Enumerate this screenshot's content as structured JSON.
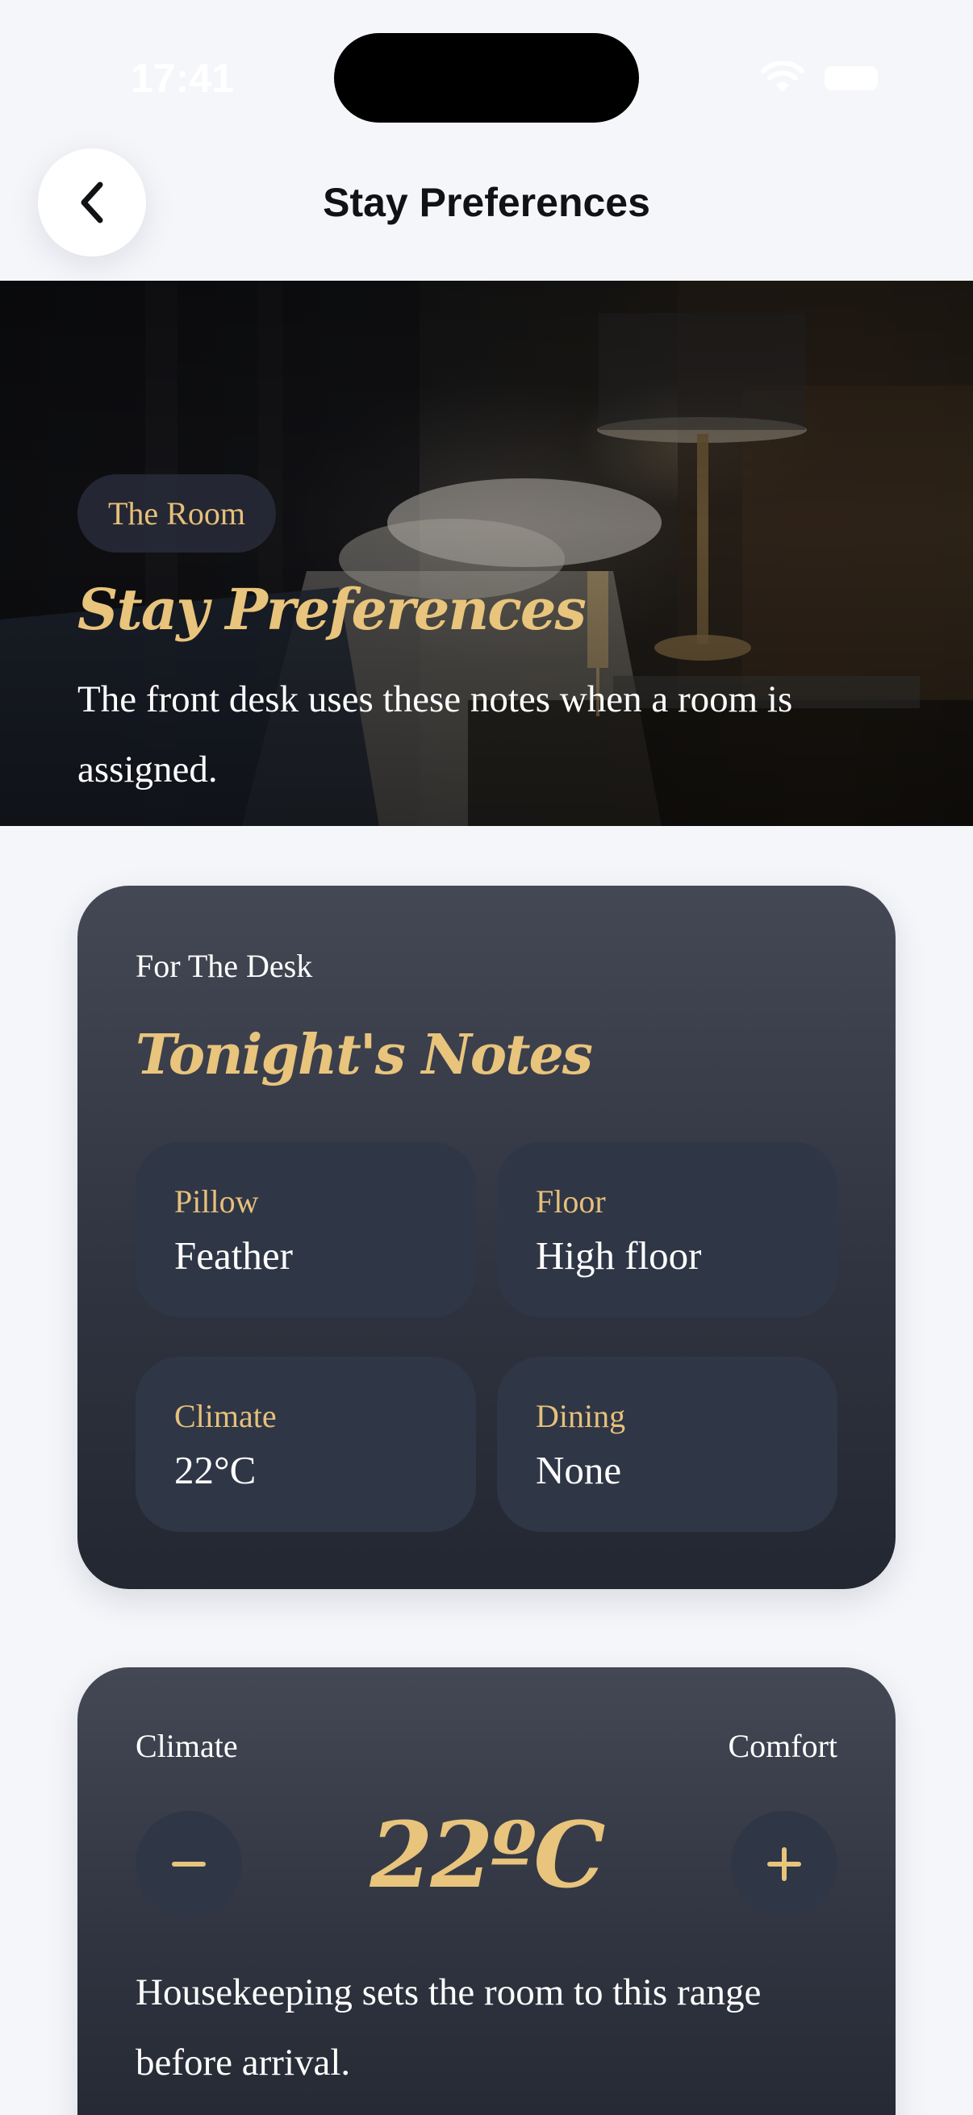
{
  "status_bar": {
    "time": "17:41"
  },
  "header": {
    "title": "Stay Preferences",
    "back_icon": "chevron-left-icon"
  },
  "hero": {
    "tag": "The Room",
    "title": "Stay Preferences",
    "description": "The front desk uses these notes when a room is assigned."
  },
  "notes_card": {
    "eyebrow": "For The Desk",
    "title": "Tonight's Notes",
    "items": [
      {
        "label": "Pillow",
        "value": "Feather"
      },
      {
        "label": "Floor",
        "value": "High floor"
      },
      {
        "label": "Climate",
        "value": "22°C"
      },
      {
        "label": "Dining",
        "value": "None"
      }
    ]
  },
  "climate_card": {
    "label": "Climate",
    "comfort_label": "Comfort",
    "temperature": "22ºC",
    "decrease_icon": "minus-icon",
    "increase_icon": "plus-icon",
    "description": "Housekeeping sets the room to this range before arrival."
  },
  "colors": {
    "accent": "#e8c47c",
    "page_background": "#f5f6fa",
    "card_top": "#444854",
    "card_bottom": "#232731",
    "tile": "#2f3646"
  }
}
